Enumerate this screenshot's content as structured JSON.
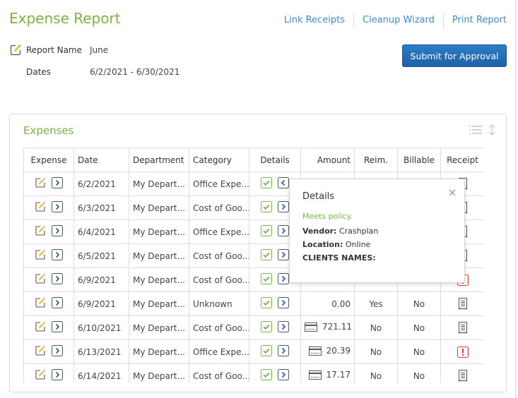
{
  "header": {
    "title": "Expense Report",
    "links": [
      "Link Receipts",
      "Cleanup Wizard",
      "Print Report"
    ],
    "report_name_label": "Report Name",
    "report_name_value": "June",
    "dates_label": "Dates",
    "dates_value": "6/2/2021 - 6/30/2021",
    "submit_label": "Submit for Approval"
  },
  "colors": {
    "accent_green": "#7cb342",
    "link_blue": "#3d8bd4",
    "button_blue": "#1f6db5",
    "alert_red": "#e53935"
  },
  "expenses": {
    "title": "Expenses",
    "columns": [
      "Expense",
      "Date",
      "Department",
      "Category",
      "Details",
      "Amount",
      "Reim.",
      "Billable",
      "Receipt"
    ],
    "rows": [
      {
        "date": "6/2/2021",
        "department": "My Depart...",
        "category": "Office Expe...",
        "details_expanded": true,
        "amount": "",
        "card": false,
        "reim": "",
        "billable": "",
        "receipt": "receipt",
        "flag": false
      },
      {
        "date": "6/3/2021",
        "department": "My Depart...",
        "category": "Cost of Goo...",
        "details_expanded": false,
        "amount": "",
        "card": false,
        "reim": "",
        "billable": "",
        "receipt": "receipt",
        "flag": false
      },
      {
        "date": "6/4/2021",
        "department": "My Depart...",
        "category": "Office Expe...",
        "details_expanded": false,
        "amount": "",
        "card": false,
        "reim": "",
        "billable": "",
        "receipt": "receipt",
        "flag": false
      },
      {
        "date": "6/5/2021",
        "department": "My Depart...",
        "category": "Cost of Goo...",
        "details_expanded": false,
        "amount": "",
        "card": false,
        "reim": "",
        "billable": "",
        "receipt": "receipt",
        "flag": false
      },
      {
        "date": "6/9/2021",
        "department": "My Depart...",
        "category": "Cost of Goo...",
        "details_expanded": false,
        "amount": "",
        "card": false,
        "reim": "",
        "billable": "",
        "receipt": "missing",
        "flag": false
      },
      {
        "date": "6/9/2021",
        "department": "My Depart...",
        "category": "Unknown",
        "details_expanded": false,
        "amount": "0.00",
        "card": false,
        "reim": "Yes",
        "billable": "No",
        "receipt": "receipt",
        "flag": true
      },
      {
        "date": "6/10/2021",
        "department": "My Depart...",
        "category": "Cost of Goo...",
        "details_expanded": false,
        "amount": "721.11",
        "card": true,
        "reim": "No",
        "billable": "No",
        "receipt": "receipt",
        "flag": false
      },
      {
        "date": "6/13/2021",
        "department": "My Depart...",
        "category": "Office Expe...",
        "details_expanded": false,
        "amount": "20.39",
        "card": true,
        "reim": "No",
        "billable": "No",
        "receipt": "missing",
        "flag": false
      },
      {
        "date": "6/14/2021",
        "department": "My Depart...",
        "category": "Cost of Goo...",
        "details_expanded": false,
        "amount": "17.17",
        "card": true,
        "reim": "No",
        "billable": "No",
        "receipt": "receipt",
        "flag": false
      }
    ]
  },
  "popover": {
    "title": "Details",
    "policy": "Meets policy.",
    "vendor_label": "Vendor:",
    "vendor_value": "Crashplan",
    "location_label": "Location:",
    "location_value": "Online",
    "clients_label": "CLIENTS NAMES:",
    "clients_value": ""
  }
}
